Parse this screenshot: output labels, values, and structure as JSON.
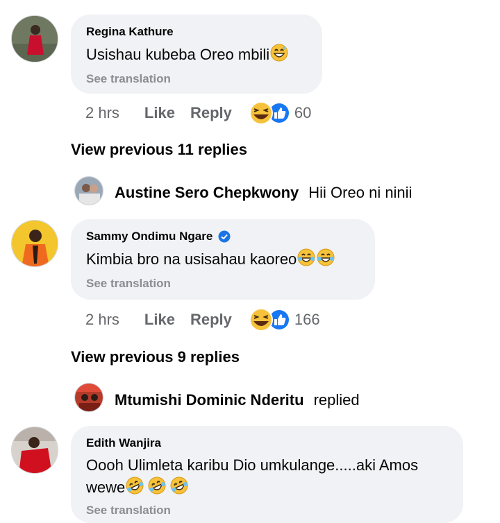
{
  "comments": [
    {
      "author": "Regina Kathure",
      "text": "Usishau kubeba Oreo mbili",
      "see_translation": "See translation",
      "time": "2 hrs",
      "like": "Like",
      "reply": "Reply",
      "reaction_count": "60",
      "view_previous": "View previous 11 replies",
      "last_reply": {
        "author": "Austine Sero Chepkwony",
        "text": "Hii Oreo ni ninii"
      }
    },
    {
      "author": "Sammy Ondimu Ngare",
      "text": "Kimbia bro na usisahau kaoreo",
      "see_translation": "See translation",
      "time": "2 hrs",
      "like": "Like",
      "reply": "Reply",
      "reaction_count": "166",
      "view_previous": "View previous 9 replies",
      "last_reply": {
        "author": "Mtumishi Dominic Nderitu",
        "text": "replied"
      }
    },
    {
      "author": "Edith Wanjira",
      "text_line1": "Oooh Ulimleta karibu Dio umkulange.....aki Amos",
      "text_line2": "wewe",
      "see_translation": "See translation"
    }
  ],
  "colors": {
    "bubble": "#f0f2f5",
    "like_blue": "#1877f2",
    "muted": "#65676b",
    "verified": "#1b74e4"
  }
}
